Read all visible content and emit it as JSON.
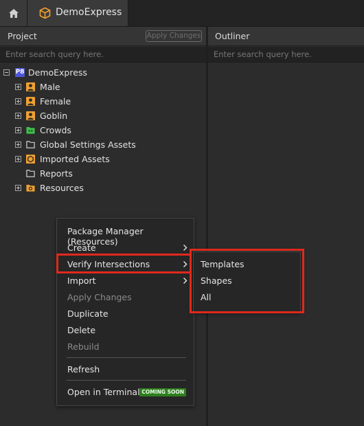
{
  "tabs": {
    "home_icon": "home-icon",
    "document": {
      "label": "DemoExpress",
      "icon": "cube-icon",
      "accent": "#f0a030"
    }
  },
  "project": {
    "title": "Project",
    "apply_changes": "Apply Changes",
    "search_placeholder": "Enter search query here.",
    "tree": {
      "root": {
        "label": "DemoExpress",
        "badge": "P8"
      },
      "items": [
        {
          "label": "Male",
          "icon": "person-icon"
        },
        {
          "label": "Female",
          "icon": "person-icon"
        },
        {
          "label": "Goblin",
          "icon": "person-icon"
        },
        {
          "label": "Crowds",
          "icon": "crowds-folder-icon"
        },
        {
          "label": "Global Settings Assets",
          "icon": "folder-icon"
        },
        {
          "label": "Imported Assets",
          "icon": "imported-assets-icon"
        },
        {
          "label": "Reports",
          "icon": "folder-icon"
        },
        {
          "label": "Resources",
          "icon": "resources-folder-icon"
        }
      ]
    }
  },
  "outliner": {
    "title": "Outliner",
    "search_placeholder": "Enter search query here."
  },
  "context_menu": {
    "items": [
      {
        "label": "Package Manager (Resources)",
        "enabled": true
      },
      {
        "label": "Create",
        "enabled": true,
        "submenu": true
      },
      {
        "label": "Verify Intersections",
        "enabled": true,
        "submenu": true,
        "highlighted": true
      },
      {
        "label": "Import",
        "enabled": true,
        "submenu": true
      },
      {
        "label": "Apply Changes",
        "enabled": false
      },
      {
        "label": "Duplicate",
        "enabled": true
      },
      {
        "label": "Delete",
        "enabled": true
      },
      {
        "label": "Rebuild",
        "enabled": false
      },
      {
        "label": "Refresh",
        "enabled": true
      },
      {
        "label": "Open in Terminal",
        "enabled": true,
        "badge": "COMING SOON"
      }
    ],
    "submenu": {
      "items": [
        {
          "label": "Templates"
        },
        {
          "label": "Shapes"
        },
        {
          "label": "All"
        }
      ]
    }
  },
  "colors": {
    "highlight_border": "#e0291d",
    "person_icon": "#f0a030",
    "crowds_icon": "#3fbf4a",
    "p8_badge": "#4d55d8",
    "coming_soon_badge": "#2f7d1e"
  }
}
